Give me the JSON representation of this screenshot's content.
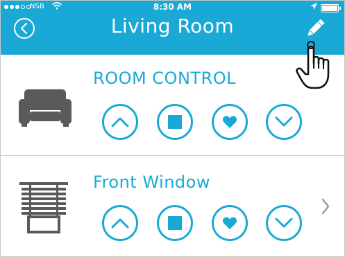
{
  "status_bar": {
    "carrier": "NSB",
    "time": "8:30 AM"
  },
  "header": {
    "title": "Living Room"
  },
  "sections": [
    {
      "title": "ROOM CONTROL",
      "icon": "armchair-icon",
      "buttons": [
        "up-icon",
        "stop-icon",
        "heart-icon",
        "down-icon"
      ]
    },
    {
      "title": "Front Window",
      "icon": "window-blind-icon",
      "buttons": [
        "up-icon",
        "stop-icon",
        "heart-icon",
        "down-icon"
      ],
      "has_chevron": true
    }
  ],
  "colors": {
    "accent": "#1aa9d6",
    "icon_gray": "#5a5a5a",
    "divider": "#cfcfcf"
  }
}
